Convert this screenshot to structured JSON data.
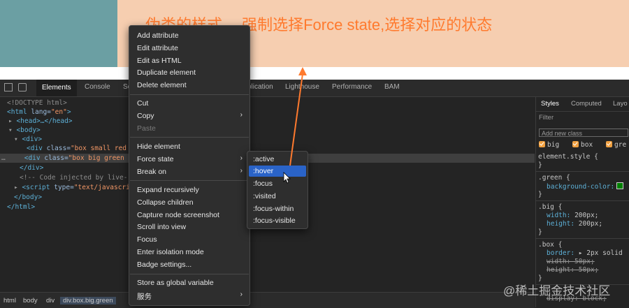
{
  "annotation": {
    "text": "伪类的样式， 强制选择Force state,选择对应的状态",
    "color": "#ff7a2e"
  },
  "page": {
    "bg_color": "#f6ceb0",
    "teal_color": "#6b9fa3"
  },
  "devtools": {
    "tabs": [
      "Elements",
      "Console",
      "Sc",
      "plication",
      "Lighthouse",
      "Performance",
      "BAM"
    ],
    "active_tab": "Elements",
    "dom_lines": {
      "doctype": "<!DOCTYPE html>",
      "html_open": {
        "tag": "<html",
        "attr": " lang=",
        "val": "\"en\"",
        "close": ">"
      },
      "head": "<head>…</head>",
      "body_open": "<body>",
      "div_open": "<div>",
      "div1": {
        "tag": "<div",
        "attr": " class=",
        "val": "\"box small red"
      },
      "div2": {
        "tag": "<div",
        "attr": " class=",
        "val": "\"box big green"
      },
      "div_close": "</div>",
      "comment": "<!-- Code injected by live-",
      "script": {
        "tag": "<script",
        "attr": " type=",
        "val": "\"text/javascri"
      },
      "body_close": "</body>",
      "html_close": "</html>"
    },
    "breadcrumbs": [
      "html",
      "body",
      "div",
      "div.box.big.green"
    ]
  },
  "styles_panel": {
    "tabs": [
      "Styles",
      "Computed",
      "Layo"
    ],
    "filter_placeholder": "Filter",
    "new_class_placeholder": "Add new class",
    "classes": [
      "big",
      "box",
      "gre"
    ],
    "element_style": "element.style {",
    "close_brace": "}",
    "green_selector": ".green {",
    "green_prop": "background-color:",
    "big_selector": ".big {",
    "big_width": "width:",
    "big_width_val": "200px;",
    "big_height": "height:",
    "big_height_val": "200px;",
    "box_selector": ".box {",
    "box_border": "border:",
    "box_border_val": "▸ 2px solid",
    "box_width": "width: 50px;",
    "box_height": "height: 50px;",
    "div_display": "display: block;",
    "green_color": "#008000"
  },
  "context_menu": {
    "items": [
      "Add attribute",
      "Edit attribute",
      "Edit as HTML",
      "Duplicate element",
      "Delete element",
      "Cut",
      "Copy",
      "Paste",
      "Hide element",
      "Force state",
      "Break on",
      "Expand recursively",
      "Collapse children",
      "Capture node screenshot",
      "Scroll into view",
      "Focus",
      "Enter isolation mode",
      "Badge settings...",
      "Store as global variable",
      "服务"
    ],
    "submenu_arrow": "›"
  },
  "force_state_submenu": {
    "items": [
      ":active",
      ":hover",
      ":focus",
      ":visited",
      ":focus-within",
      ":focus-visible"
    ],
    "highlighted": ":hover"
  },
  "watermark": "@稀土掘金技术社区"
}
